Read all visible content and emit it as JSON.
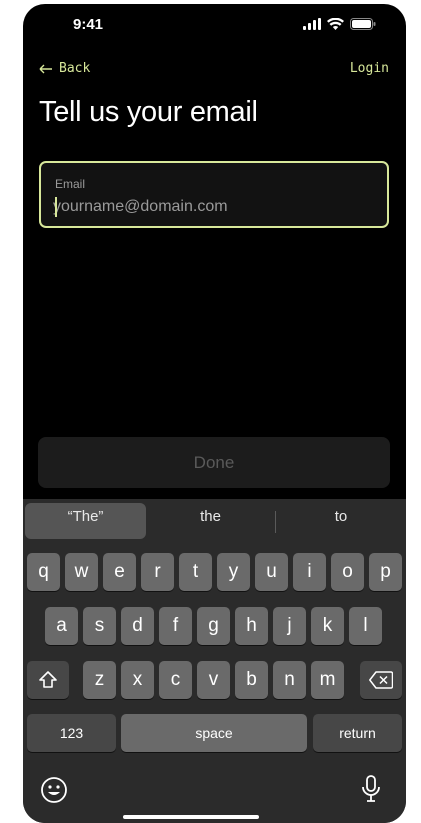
{
  "status_bar": {
    "time": "9:41"
  },
  "nav": {
    "back_label": "Back",
    "login_label": "Login"
  },
  "title": "Tell us your email",
  "email_field": {
    "label": "Email",
    "placeholder": "yourname@domain.com",
    "value": ""
  },
  "done_label": "Done",
  "keyboard": {
    "suggestions": [
      "“The”",
      "the",
      "to"
    ],
    "row1": [
      "q",
      "w",
      "e",
      "r",
      "t",
      "y",
      "u",
      "i",
      "o",
      "p"
    ],
    "row2": [
      "a",
      "s",
      "d",
      "f",
      "g",
      "h",
      "j",
      "k",
      "l"
    ],
    "row3": [
      "z",
      "x",
      "c",
      "v",
      "b",
      "n",
      "m"
    ],
    "numbers_label": "123",
    "space_label": "space",
    "return_label": "return"
  },
  "colors": {
    "accent": "#d7e79a",
    "background": "#000000",
    "keyboard": "#2b2b2b",
    "key": "#6a6a6a"
  },
  "icons": [
    "back-arrow-icon",
    "signal-icon",
    "wifi-icon",
    "battery-icon",
    "shift-icon",
    "backspace-icon",
    "emoji-icon",
    "microphone-icon"
  ]
}
